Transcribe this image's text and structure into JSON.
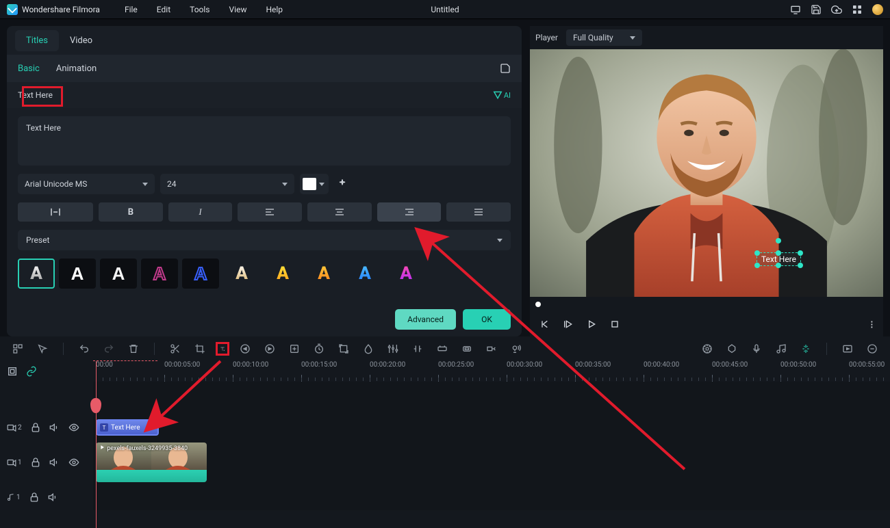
{
  "app": {
    "name": "Wondershare Filmora",
    "document": "Untitled"
  },
  "menus": [
    "File",
    "Edit",
    "Tools",
    "View",
    "Help"
  ],
  "topTabs": {
    "titles": "Titles",
    "video": "Video"
  },
  "subTabs": {
    "basic": "Basic",
    "animation": "Animation"
  },
  "titleEditor": {
    "sectionLabel": "Text Here",
    "textValue": "Text Here",
    "font": "Arial Unicode MS",
    "fontSize": "24",
    "presetLabel": "Preset",
    "advanced": "Advanced",
    "ok": "OK",
    "aiLabel": "AI"
  },
  "presets": [
    {
      "fill": "linear-gradient(#fff,#999)",
      "stroke": ""
    },
    {
      "fill": "#fff",
      "stroke": ""
    },
    {
      "fill": "#f5f5f5",
      "stroke": ""
    },
    {
      "fill": "transparent",
      "stroke": "#c13a8b"
    },
    {
      "fill": "transparent",
      "stroke": "#3860ff"
    },
    {
      "fill": "linear-gradient(#fff,#d8b063)",
      "stroke": ""
    },
    {
      "fill": "linear-gradient(#ffea3c,#ff9b1a)",
      "stroke": ""
    },
    {
      "fill": "linear-gradient(#ffd23c,#ff7b1a)",
      "stroke": ""
    },
    {
      "fill": "linear-gradient(#4fc3ff,#2278ff)",
      "stroke": ""
    },
    {
      "fill": "linear-gradient(#ff4da8,#b02bff)",
      "stroke": ""
    }
  ],
  "player": {
    "label": "Player",
    "quality": "Full Quality",
    "overlayText": "Text Here"
  },
  "timeline": {
    "timecodes": [
      "00:00",
      "00:00:05:00",
      "00:00:10:00",
      "00:00:15:00",
      "00:00:20:00",
      "00:00:25:00",
      "00:00:30:00",
      "00:00:35:00",
      "00:00:40:00",
      "00:00:45:00",
      "00:00:50:00",
      "00:00:55:00"
    ],
    "titleClipLabel": "Text Here",
    "videoClipFilename": "pexels-fauxels-3249935-3840",
    "trackLabels": {
      "video2": "2",
      "video1": "1",
      "audio1": "1"
    }
  }
}
